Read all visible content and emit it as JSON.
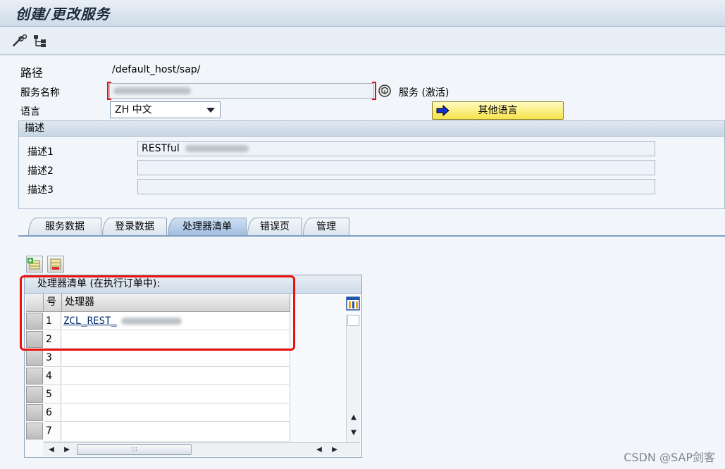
{
  "window": {
    "title": "创建/更改服务"
  },
  "toolbar": {
    "edit_icon": "pencil-glasses-icon",
    "tree_icon": "hierarchy-tree-icon"
  },
  "header": {
    "path_label": "路径",
    "path_value": "/default_host/sap/",
    "service_name_label": "服务名称",
    "service_status": "服务 (激活)",
    "language_label": "语言",
    "language_value": "ZH 中文",
    "other_languages_button": "其他语言"
  },
  "description": {
    "group_title": "描述",
    "rows": [
      {
        "label": "描述1",
        "value": "RESTful"
      },
      {
        "label": "描述2",
        "value": ""
      },
      {
        "label": "描述3",
        "value": ""
      }
    ]
  },
  "tabs": [
    {
      "label": "服务数据"
    },
    {
      "label": "登录数据"
    },
    {
      "label": "处理器清单"
    },
    {
      "label": "错误页"
    },
    {
      "label": "管理"
    }
  ],
  "handler_table": {
    "title": "处理器清单 (在执行订单中):",
    "columns": {
      "num": "号",
      "handler": "处理器"
    },
    "rows": [
      {
        "num": "1",
        "handler": "ZCL_REST_"
      },
      {
        "num": "2",
        "handler": ""
      },
      {
        "num": "3",
        "handler": ""
      },
      {
        "num": "4",
        "handler": ""
      },
      {
        "num": "5",
        "handler": ""
      },
      {
        "num": "6",
        "handler": ""
      },
      {
        "num": "7",
        "handler": ""
      }
    ],
    "hscroll_grip": ":::"
  },
  "watermark": "CSDN @SAP剑客",
  "colors": {
    "accent_yellow": "#f7e34c",
    "highlight_red": "#e11111",
    "tab_active": "#9fbde0"
  }
}
